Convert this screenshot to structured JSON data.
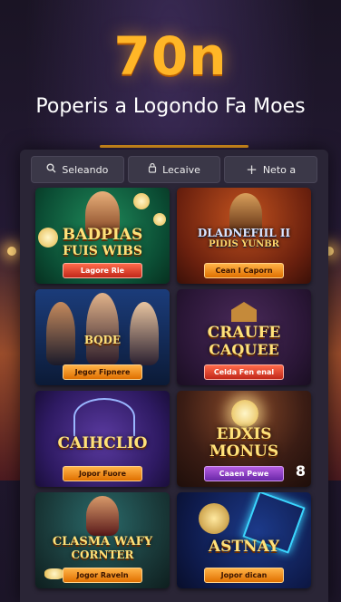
{
  "hero": {
    "number": "70n",
    "subtitle": "Poperis a Logondo Fa Moes"
  },
  "tabs": [
    {
      "icon": "search-icon",
      "glyph": "🔍︎",
      "label": "Seleando"
    },
    {
      "icon": "lock-icon",
      "glyph": "▢",
      "label": "Lecaive"
    },
    {
      "icon": "plus-icon",
      "glyph": "+",
      "label": "Neto a"
    }
  ],
  "games": [
    {
      "title_line1": "BADPIAS",
      "title_line2": "FUIS WIBS",
      "button": "Lagore Rie"
    },
    {
      "title_line1": "DLADNEFIIL II",
      "title_line2": "PIDIS YUNBR",
      "button": "Cean I Caporn"
    },
    {
      "title_line1": "BQDE",
      "title_line2": "",
      "button": "Jegor Fipnere"
    },
    {
      "title_line1": "CRAUFE",
      "title_line2": "CAQUEE",
      "button": "Celda Fen enal"
    },
    {
      "title_line1": "CAIHCLIO",
      "title_line2": "",
      "button": "Jopor Fuore"
    },
    {
      "title_line1": "EDXIS",
      "title_line2": "MONUS",
      "button": "Caaen Pewe",
      "badge": "8"
    },
    {
      "title_line1": "CLASMA WAFY",
      "title_line2": "CORNTER",
      "button": "Jogor Raveln"
    },
    {
      "title_line1": "ASTNAY",
      "title_line2": "",
      "button": "Jopor dican"
    }
  ]
}
